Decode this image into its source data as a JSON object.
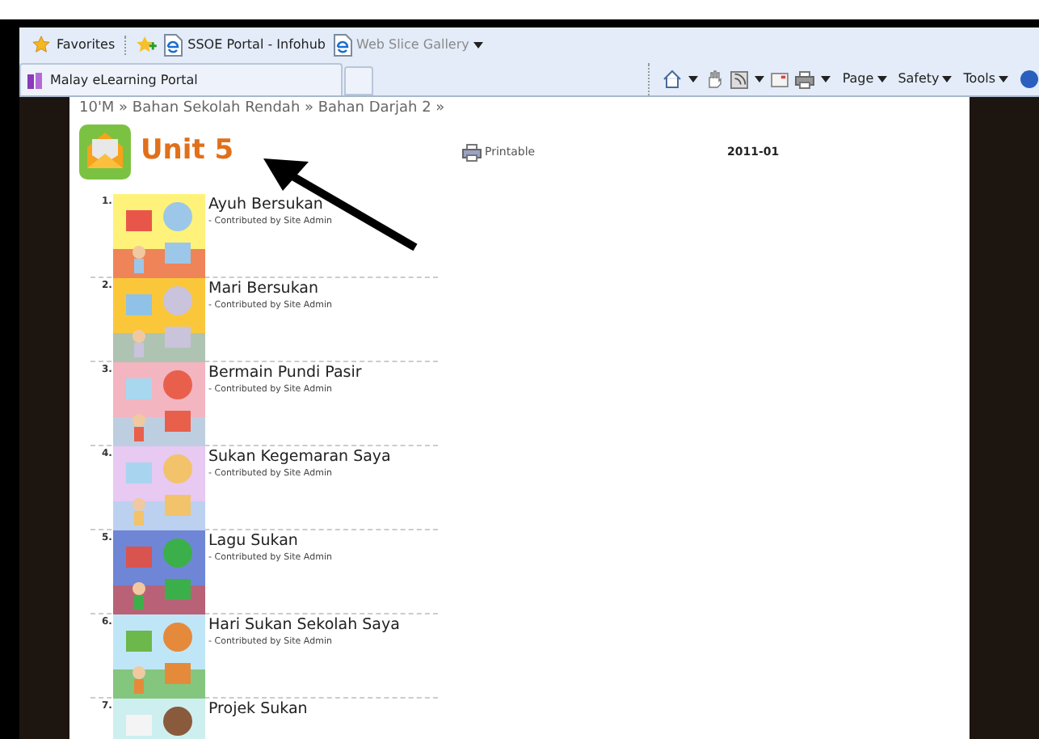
{
  "favorites_bar": {
    "favorites": "Favorites",
    "links": [
      {
        "label": "SSOE Portal - Infohub",
        "disabled": false
      },
      {
        "label": "Web Slice Gallery",
        "disabled": true,
        "dropdown": true
      }
    ]
  },
  "tab": {
    "title": "Malay eLearning Portal"
  },
  "command_bar": [
    "Page",
    "Safety",
    "Tools"
  ],
  "breadcrumb": "10'M » Bahan Sekolah Rendah » Bahan Darjah 2 »",
  "unit": {
    "title": "Unit 5",
    "printable": "Printable",
    "date": "2011-01"
  },
  "items": [
    {
      "number": "1.",
      "title": "Ayuh Bersukan",
      "byline": "- Contributed by Site Admin"
    },
    {
      "number": "2.",
      "title": "Mari Bersukan",
      "byline": "- Contributed by Site Admin"
    },
    {
      "number": "3.",
      "title": "Bermain Pundi Pasir",
      "byline": "- Contributed by Site Admin"
    },
    {
      "number": "4.",
      "title": "Sukan Kegemaran Saya",
      "byline": "- Contributed by Site Admin"
    },
    {
      "number": "5.",
      "title": "Lagu Sukan",
      "byline": "- Contributed by Site Admin"
    },
    {
      "number": "6.",
      "title": "Hari Sukan Sekolah Saya",
      "byline": "- Contributed by Site Admin"
    },
    {
      "number": "7.",
      "title": "Projek Sukan"
    }
  ]
}
